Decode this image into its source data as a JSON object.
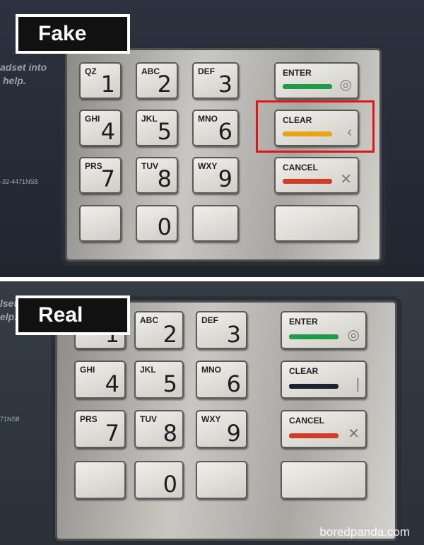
{
  "fake": {
    "label": "Fake",
    "side_text": [
      "adset into",
      "help."
    ],
    "small_print": "-32-4471NS8",
    "keys": [
      [
        "QZ",
        "1"
      ],
      [
        "ABC",
        "2"
      ],
      [
        "DEF",
        "3"
      ],
      [
        "GHI",
        "4"
      ],
      [
        "JKL",
        "5"
      ],
      [
        "MNO",
        "6"
      ],
      [
        "PRS",
        "7"
      ],
      [
        "TUV",
        "8"
      ],
      [
        "WXY",
        "9"
      ],
      [
        "",
        ""
      ],
      [
        "",
        "0"
      ],
      [
        "",
        ""
      ]
    ],
    "function_keys": [
      {
        "label": "ENTER",
        "color": "#1e9a4a",
        "icon": "circle-icon"
      },
      {
        "label": "CLEAR",
        "color": "#e8a418",
        "icon": "chevron-left-icon"
      },
      {
        "label": "CANCEL",
        "color": "#d23a2a",
        "icon": "x-icon"
      },
      {
        "label": "",
        "color": "",
        "icon": ""
      }
    ],
    "highlight_color": "#e0141c"
  },
  "real": {
    "label": "Real",
    "side_text": [
      "lset into",
      "elp."
    ],
    "small_print": "71NS8",
    "keys": [
      [
        "",
        "1"
      ],
      [
        "ABC",
        "2"
      ],
      [
        "DEF",
        "3"
      ],
      [
        "GHI",
        "4"
      ],
      [
        "JKL",
        "5"
      ],
      [
        "MNO",
        "6"
      ],
      [
        "PRS",
        "7"
      ],
      [
        "TUV",
        "8"
      ],
      [
        "WXY",
        "9"
      ],
      [
        "",
        ""
      ],
      [
        "",
        "0"
      ],
      [
        "",
        ""
      ]
    ],
    "function_keys": [
      {
        "label": "ENTER",
        "color": "#1e9a4a",
        "icon": "circle-icon"
      },
      {
        "label": "CLEAR",
        "color": "#1d2233",
        "icon": "bar-icon"
      },
      {
        "label": "CANCEL",
        "color": "#d23a2a",
        "icon": "x-icon"
      },
      {
        "label": "",
        "color": "",
        "icon": ""
      }
    ]
  },
  "watermark": "boredpanda.com"
}
